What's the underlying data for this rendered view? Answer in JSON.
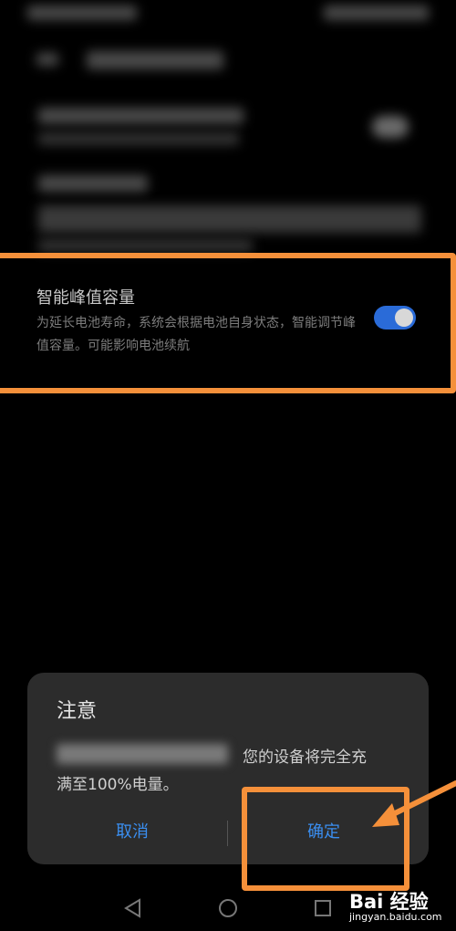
{
  "setting": {
    "title": "智能峰值容量",
    "description": "为延长电池寿命，系统会根据电池自身状态，智能调节峰值容量。可能影响电池续航",
    "toggle_on": true
  },
  "dialog": {
    "title": "注意",
    "message_line1": "您的设备将完全充",
    "message_line2": "满至100%电量。",
    "cancel_label": "取消",
    "confirm_label": "确定"
  },
  "watermark": {
    "logo_text": "Bai 经验",
    "url": "jingyan.baidu.com"
  },
  "colors": {
    "accent": "#3a8ef0",
    "toggle_track": "#2a6bd8",
    "highlight": "#f5903a",
    "dialog_bg": "#2c2c2c"
  },
  "icons": {
    "back": "triangle-back-icon",
    "home": "circle-home-icon",
    "recents": "square-recents-icon"
  }
}
